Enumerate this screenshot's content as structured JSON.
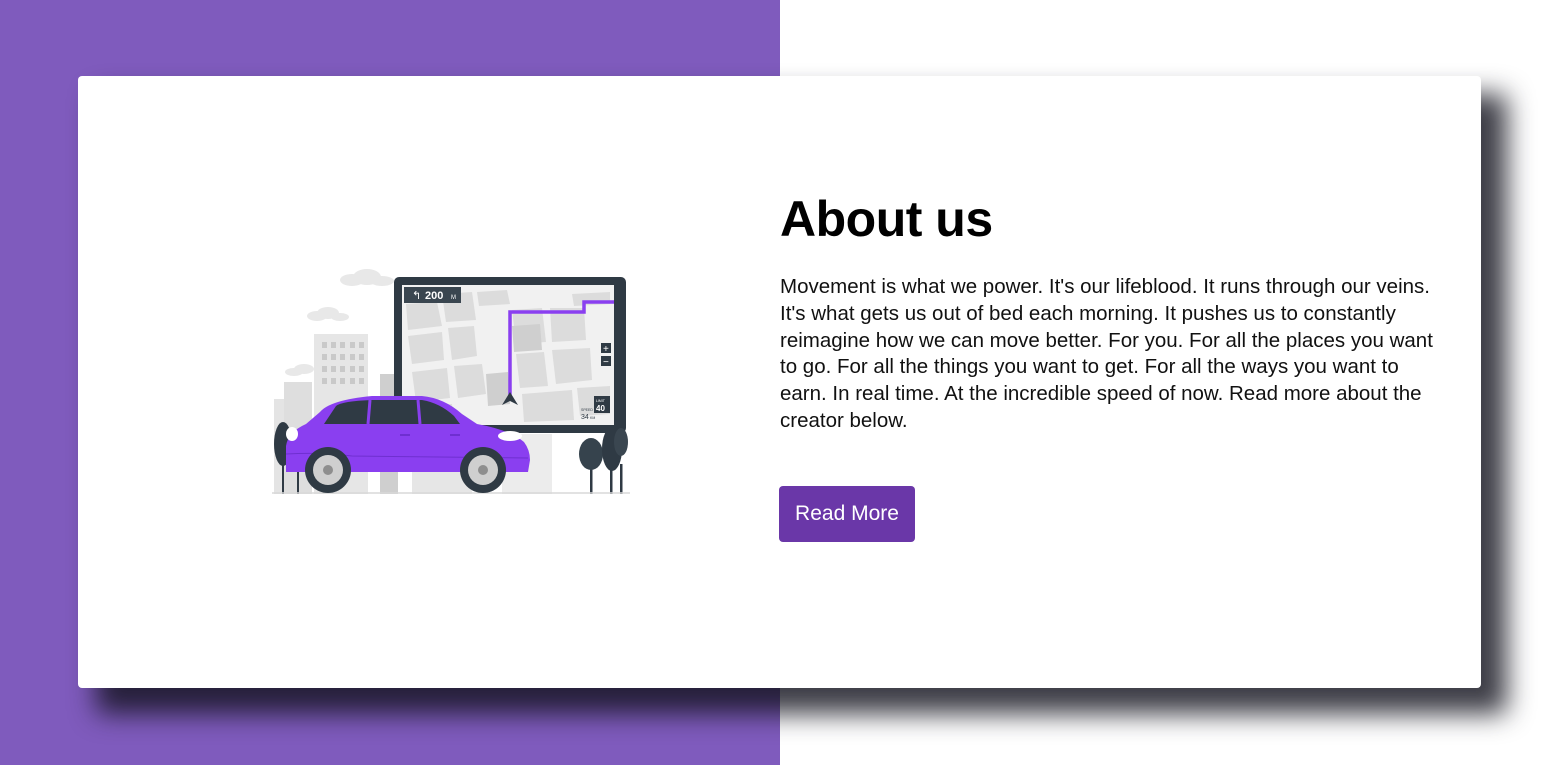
{
  "about": {
    "title": "About us",
    "description": "Movement is what we power. It's our lifeblood. It runs through our veins. It's what gets us out of bed each morning. It pushes us to constantly reimagine how we can move better. For you. For all the places you want to go. For all the things you want to get. For all the ways you want to earn. In real time. At the incredible speed of now. Read more about the creator below.",
    "button_label": "Read More"
  },
  "illustration": {
    "icon": "car-navigation-illustration",
    "nav_distance": "200",
    "nav_unit": "M",
    "speed_limit": "40",
    "speed_label": "LIMIT",
    "current_speed": "34",
    "current_speed_unit": "KM",
    "current_speed_label": "SPEED",
    "zoom_in": "+",
    "zoom_out": "−"
  },
  "colors": {
    "brand_purple": "#7f5bbd",
    "button_purple": "#6a37a8",
    "car_purple": "#8a3ff0",
    "route_purple": "#8a3ff0",
    "dark_slate": "#2f3a44"
  }
}
